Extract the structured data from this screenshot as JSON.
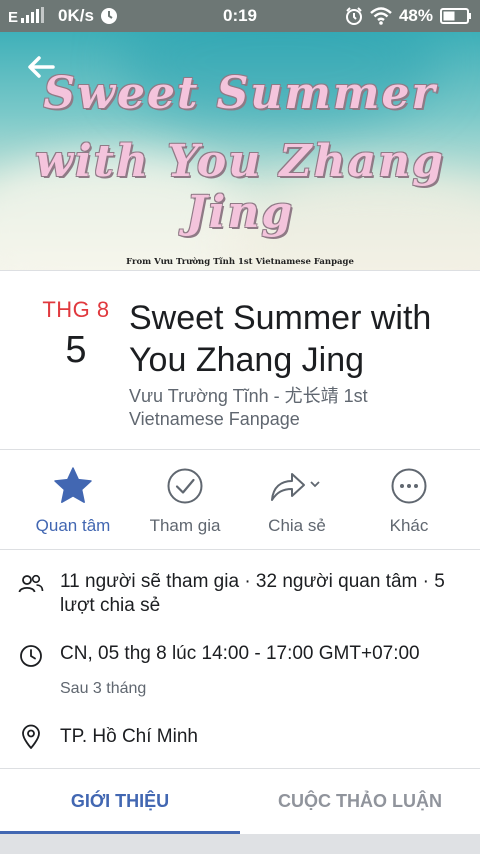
{
  "status_bar": {
    "network": "0K/s",
    "time": "0:19",
    "battery": "48%"
  },
  "cover": {
    "title_line1": "Sweet Summer",
    "title_line2": "with You Zhang Jing",
    "credit": "From Vưu Trường Tĩnh 1st Vietnamese Fanpage"
  },
  "event": {
    "month": "THG 8",
    "day": "5",
    "title": "Sweet Summer with You Zhang Jing",
    "host": "Vưu Trường Tĩnh - 尤长靖 1st Vietnamese Fanpage"
  },
  "actions": [
    {
      "label": "Quan tâm",
      "icon": "star-icon",
      "active": true
    },
    {
      "label": "Tham gia",
      "icon": "check-circle-icon",
      "active": false
    },
    {
      "label": "Chia sẻ",
      "icon": "share-icon",
      "active": false
    },
    {
      "label": "Khác",
      "icon": "more-icon",
      "active": false
    }
  ],
  "details": {
    "attendance": "11 người sẽ tham gia · 32 người quan tâm · 5 lượt chia sẻ",
    "datetime": "CN, 05 thg 8 lúc 14:00 - 17:00 GMT+07:00",
    "relative_time": "Sau 3 tháng",
    "location": "TP. Hồ Chí Minh"
  },
  "tabs": [
    {
      "label": "GIỚI THIỆU",
      "active": true
    },
    {
      "label": "CUỘC THẢO LUẬN",
      "active": false
    }
  ],
  "colors": {
    "accent": "#4267b2",
    "date_red": "#e0393e",
    "secondary_text": "#606770"
  }
}
